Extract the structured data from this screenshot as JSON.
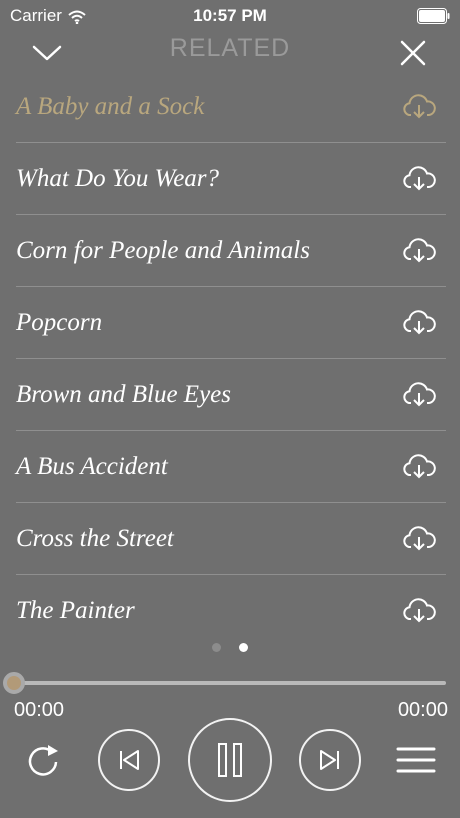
{
  "status_bar": {
    "carrier": "Carrier",
    "time": "10:57 PM",
    "icons": [
      "wifi-icon",
      "battery-icon"
    ]
  },
  "header": {
    "title": "RELATED",
    "left_icon": "chevron-down-icon",
    "right_icon": "close-icon"
  },
  "tracks": [
    {
      "title": "A Baby and a Sock",
      "active": true,
      "icon": "cloud-download-icon"
    },
    {
      "title": "What Do You Wear?",
      "active": false,
      "icon": "cloud-download-icon"
    },
    {
      "title": "Corn for People and Animals",
      "active": false,
      "icon": "cloud-download-icon"
    },
    {
      "title": "Popcorn",
      "active": false,
      "icon": "cloud-download-icon"
    },
    {
      "title": "Brown and Blue Eyes",
      "active": false,
      "icon": "cloud-download-icon"
    },
    {
      "title": "A Bus Accident",
      "active": false,
      "icon": "cloud-download-icon"
    },
    {
      "title": "Cross the Street",
      "active": false,
      "icon": "cloud-download-icon"
    },
    {
      "title": "The Painter",
      "active": false,
      "icon": "cloud-download-icon"
    }
  ],
  "pager": {
    "pages": 2,
    "current": 2
  },
  "player": {
    "elapsed": "00:00",
    "total": "00:00",
    "progress": 0,
    "controls": [
      "repeat-icon",
      "previous-icon",
      "pause-icon",
      "next-icon",
      "menu-icon"
    ]
  },
  "colors": {
    "background": "#6f6f6f",
    "accent": "#b9a77e",
    "header_title": "#9a9a9a",
    "foreground": "#ffffff"
  }
}
